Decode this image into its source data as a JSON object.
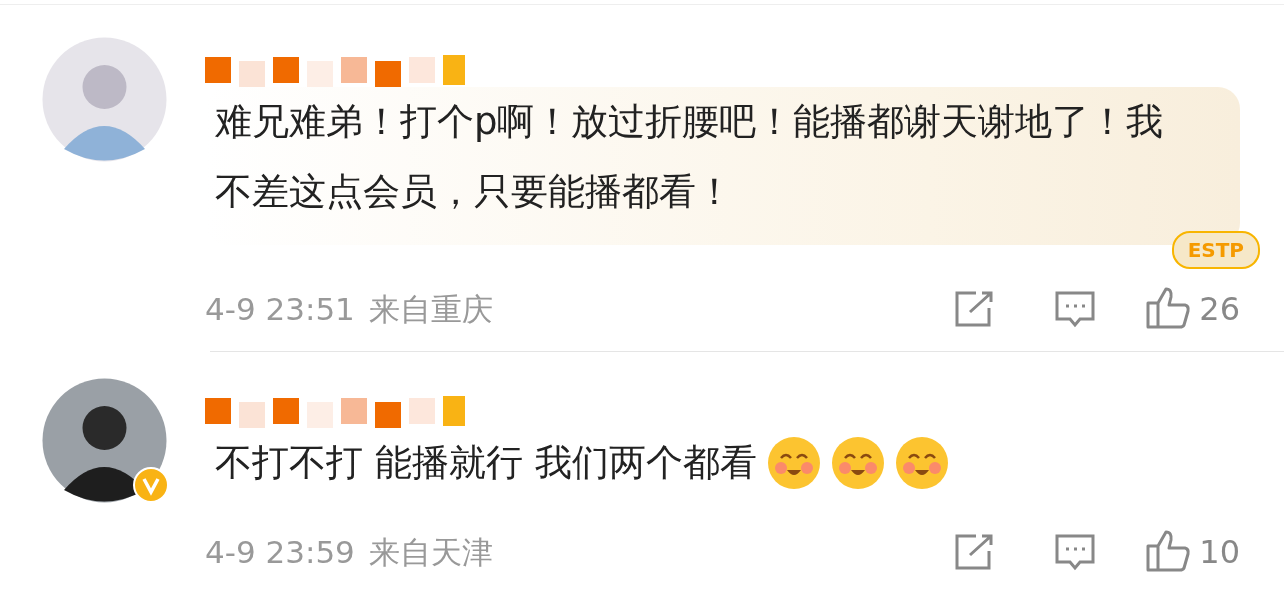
{
  "comments": [
    {
      "user": {
        "name_hidden": true,
        "verified": false
      },
      "text": "难兄难弟！打个p啊！放过折腰吧！能播都谢天谢地了！我不差这点会员，只要能播都看！",
      "personality_badge": "ESTP",
      "time": "4-9 23:51",
      "location": "来自重庆",
      "likes": "26"
    },
    {
      "user": {
        "name_hidden": true,
        "verified": true
      },
      "text": "不打不打 能播就行 我们两个都看",
      "emojis": [
        {
          "kind": "smile"
        },
        {
          "kind": "smile"
        },
        {
          "kind": "smile"
        }
      ],
      "time": "4-9 23:59",
      "location": "来自天津",
      "likes": "10"
    }
  ]
}
